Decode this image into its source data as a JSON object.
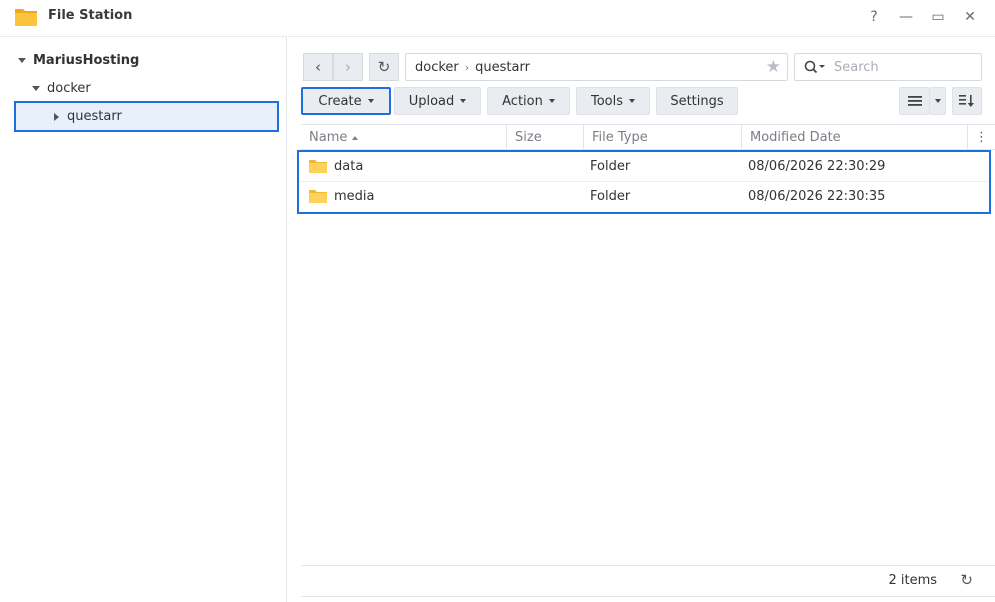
{
  "window": {
    "title": "File Station",
    "help_label": "?",
    "minimize_label": "—",
    "maximize_label": "▭",
    "close_label": "✕"
  },
  "sidebar": {
    "root": "MariusHosting",
    "items": [
      {
        "label": "docker"
      },
      {
        "label": "questarr"
      }
    ]
  },
  "nav": {
    "back_icon": "‹",
    "forward_icon": "›",
    "refresh_icon": "↻",
    "path": [
      "docker",
      "questarr"
    ],
    "path_sep": "›",
    "star_icon": "★",
    "search_placeholder": "Search"
  },
  "toolbar": {
    "create": "Create",
    "upload": "Upload",
    "action": "Action",
    "tools": "Tools",
    "settings": "Settings"
  },
  "table": {
    "columns": [
      "Name",
      "Size",
      "File Type",
      "Modified Date"
    ],
    "rows": [
      {
        "name": "data",
        "size": "",
        "type": "Folder",
        "modified": "08/06/2026 22:30:29"
      },
      {
        "name": "media",
        "size": "",
        "type": "Folder",
        "modified": "08/06/2026 22:30:35"
      }
    ]
  },
  "footer": {
    "count": "2 items"
  },
  "colors": {
    "accent": "#1d6fe0",
    "folder": "#f7c64a"
  }
}
